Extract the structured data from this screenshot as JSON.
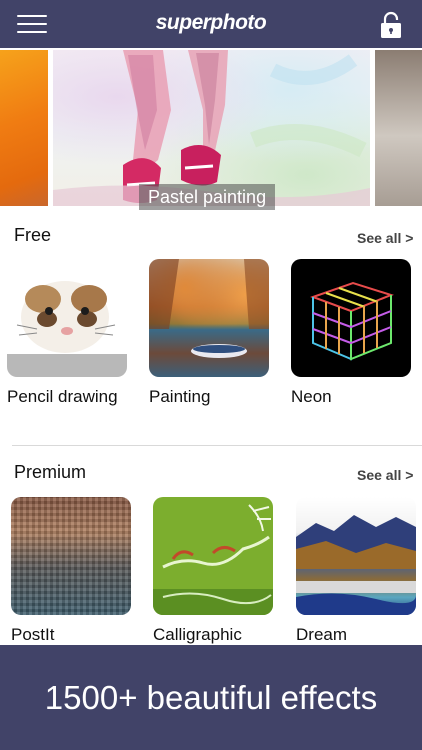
{
  "header": {
    "logo": "superphoto"
  },
  "hero": {
    "label": "Pastel painting"
  },
  "sections": [
    {
      "title": "Free",
      "see_all": "See all >",
      "items": [
        {
          "label": "Pencil drawing"
        },
        {
          "label": "Painting"
        },
        {
          "label": "Neon"
        }
      ]
    },
    {
      "title": "Premium",
      "see_all": "See all >",
      "items": [
        {
          "label": "PostIt"
        },
        {
          "label": "Calligraphic"
        },
        {
          "label": "Dream"
        }
      ]
    }
  ],
  "banner": {
    "text": "1500+ beautiful effects"
  },
  "colors": {
    "brand_bar": "#414368",
    "hero_label_bg": "#505050"
  },
  "icons": [
    "hamburger-menu-icon",
    "lock-icon"
  ]
}
